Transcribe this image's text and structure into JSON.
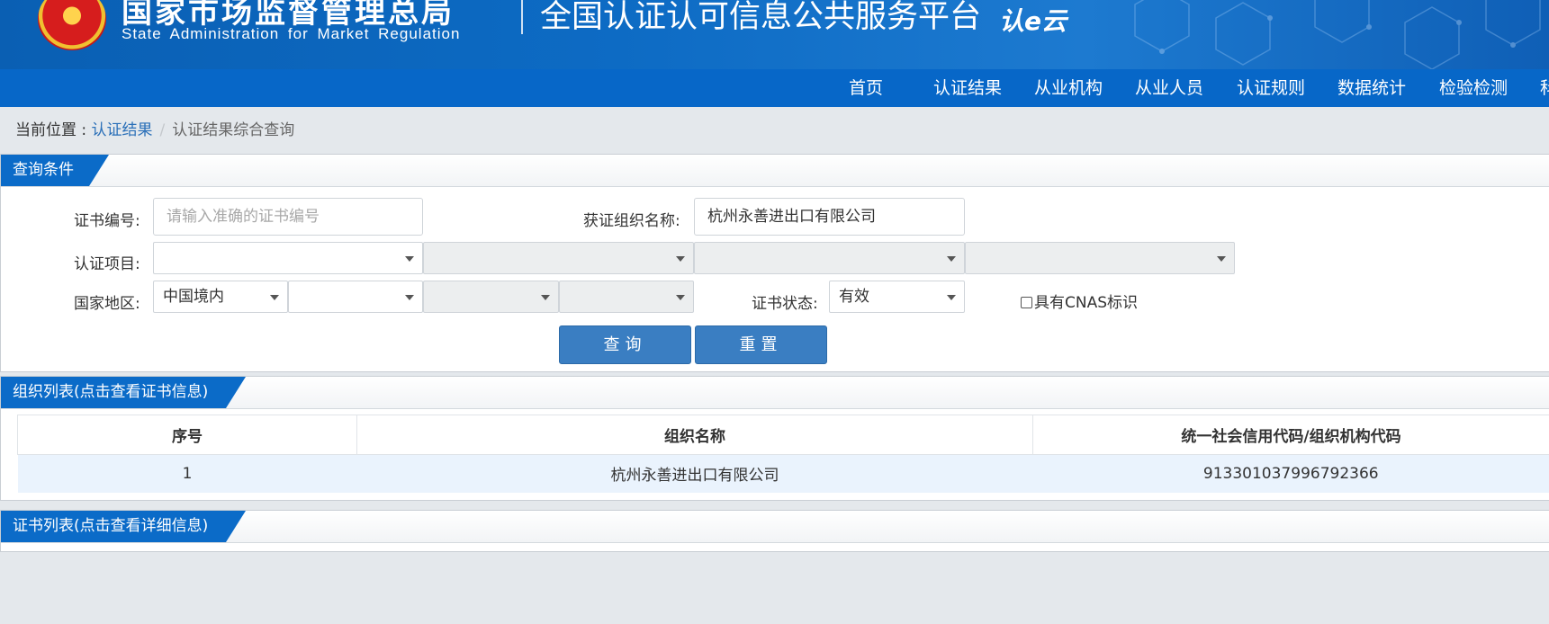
{
  "header": {
    "org_name_cn": "国家市场监督管理总局",
    "org_name_en": "State Administration  for  Market Regulation",
    "platform_title": "全国认证认可信息公共服务平台",
    "platform_logo_text": "认e云",
    "colors": {
      "brand_blue": "#0767c8",
      "header_blue": "#0a5fb3"
    }
  },
  "nav": {
    "items": [
      {
        "label": "首页"
      },
      {
        "label": "认证结果"
      },
      {
        "label": "从业机构"
      },
      {
        "label": "从业人员"
      },
      {
        "label": "认证规则"
      },
      {
        "label": "数据统计"
      },
      {
        "label": "检验检测"
      },
      {
        "label": "科"
      }
    ]
  },
  "breadcrumb": {
    "prefix": "当前位置 : ",
    "link": "认证结果",
    "separator": "/",
    "current": "认证结果综合查询"
  },
  "query_panel": {
    "title": "查询条件",
    "cert_no_label": "证书编号:",
    "cert_no_placeholder": "请输入准确的证书编号",
    "org_name_label": "获证组织名称:",
    "org_name_value": "杭州永善进出口有限公司",
    "project_label": "认证项目:",
    "region_label": "国家地区:",
    "region_value": "中国境内",
    "status_label": "证书状态:",
    "status_value": "有效",
    "cnas_label": "具有CNAS标识",
    "search_button": "查询",
    "reset_button": "重置"
  },
  "org_panel": {
    "title": "组织列表(点击查看证书信息)",
    "columns": [
      "序号",
      "组织名称",
      "统一社会信用代码/组织机构代码"
    ],
    "rows": [
      {
        "index": "1",
        "name": "杭州永善进出口有限公司",
        "code": "913301037996792366"
      }
    ]
  },
  "cert_panel": {
    "title": "证书列表(点击查看详细信息)"
  }
}
